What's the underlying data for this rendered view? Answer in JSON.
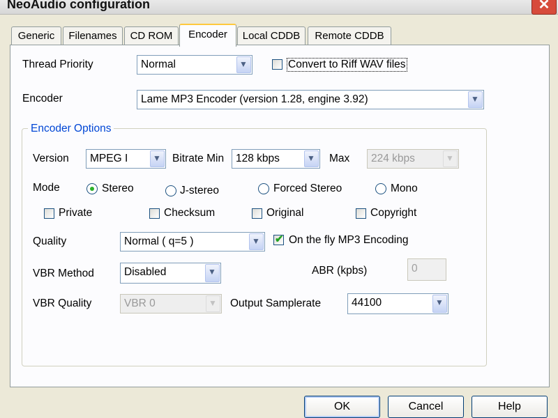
{
  "window": {
    "title": "NeoAudio configuration"
  },
  "tabs": [
    "Generic",
    "Filenames",
    "CD ROM",
    "Encoder",
    "Local CDDB",
    "Remote CDDB"
  ],
  "active_tab": "Encoder",
  "thread_priority": {
    "label": "Thread Priority",
    "value": "Normal"
  },
  "convert_riff": {
    "label": "Convert to Riff WAV files",
    "checked": false
  },
  "encoder": {
    "label": "Encoder",
    "value": "Lame MP3 Encoder (version 1.28, engine 3.92)"
  },
  "encoder_options": {
    "title": "Encoder Options",
    "version": {
      "label": "Version",
      "value": "MPEG I"
    },
    "bitrate_min": {
      "label": "Bitrate Min",
      "value": "128 kbps"
    },
    "bitrate_max": {
      "label": "Max",
      "value": "224 kbps"
    },
    "mode": {
      "label": "Mode",
      "options": [
        "Stereo",
        "J-stereo",
        "Forced Stereo",
        "Mono"
      ],
      "selected": "Stereo"
    },
    "flags": [
      {
        "label": "Private",
        "checked": false
      },
      {
        "label": "Checksum",
        "checked": false
      },
      {
        "label": "Original",
        "checked": false
      },
      {
        "label": "Copyright",
        "checked": false
      }
    ],
    "quality": {
      "label": "Quality",
      "value": "Normal ( q=5 )"
    },
    "on_the_fly": {
      "label": "On the fly MP3 Encoding",
      "checked": true
    },
    "vbr_method": {
      "label": "VBR Method",
      "value": "Disabled"
    },
    "abr": {
      "label": "ABR (kpbs)",
      "value": "0"
    },
    "vbr_quality": {
      "label": "VBR Quality",
      "value": "VBR 0"
    },
    "output_samplerate": {
      "label": "Output Samplerate",
      "value": "44100"
    }
  },
  "buttons": {
    "ok": "OK",
    "cancel": "Cancel",
    "help": "Help"
  },
  "icons": {
    "dropdown": "▼",
    "check": "✔",
    "close": "✕"
  }
}
